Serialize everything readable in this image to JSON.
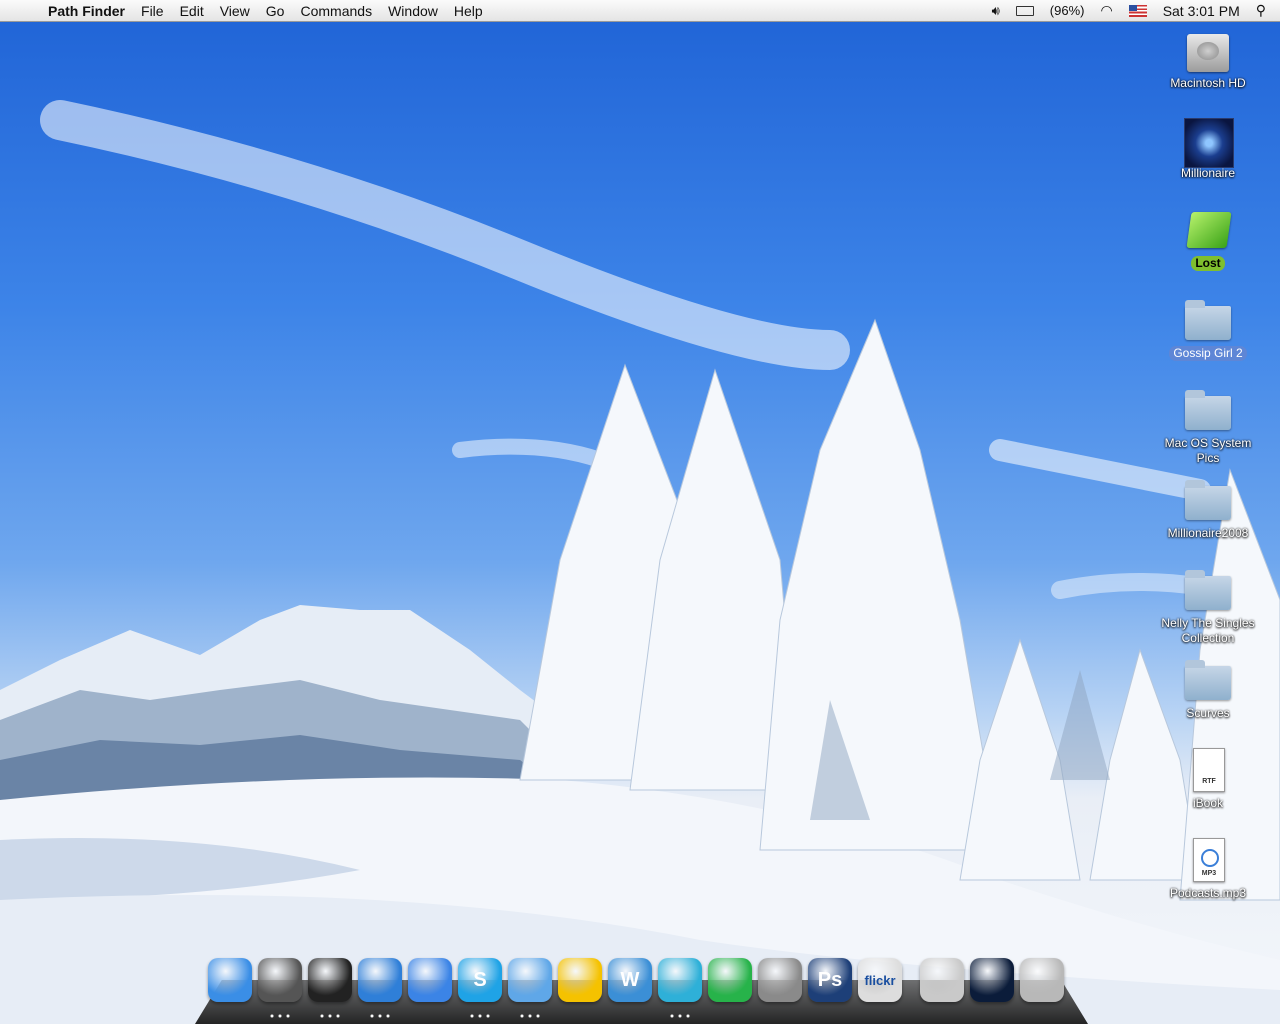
{
  "menubar": {
    "app_name": "Path Finder",
    "menus": [
      "File",
      "Edit",
      "View",
      "Go",
      "Commands",
      "Window",
      "Help"
    ],
    "battery": "(96%)",
    "clock": "Sat 3:01 PM"
  },
  "desktop_icons": [
    {
      "label": "Macintosh HD",
      "icon": "hard-drive-icon"
    },
    {
      "label": "Millionaire",
      "icon": "millionaire-app-icon"
    },
    {
      "label": "Lost",
      "icon": "green-folder-icon",
      "label_color": "#7fbf2e"
    },
    {
      "label": "Gossip Girl 2",
      "icon": "folder-icon",
      "label_color": "#5e86d6"
    },
    {
      "label": "Mac OS System Pics",
      "icon": "folder-icon"
    },
    {
      "label": "Millionaire2008",
      "icon": "folder-icon"
    },
    {
      "label": "Nelly The Singles Collection",
      "icon": "folder-icon"
    },
    {
      "label": "Scurves",
      "icon": "folder-icon"
    },
    {
      "label": "iBook",
      "icon": "rtf-document-icon",
      "badge": "RTF"
    },
    {
      "label": "Podcasts.mp3",
      "icon": "mp3-document-icon",
      "badge": "MP3"
    }
  ],
  "dock": {
    "apps": [
      {
        "name": "finder-icon",
        "running": false,
        "color": "#3a8ee6"
      },
      {
        "name": "stopwatch-icon",
        "running": true,
        "color": "#555555"
      },
      {
        "name": "dashboard-icon",
        "running": true,
        "color": "#222222"
      },
      {
        "name": "safari-icon",
        "running": true,
        "color": "#2f7fd8"
      },
      {
        "name": "ichat-icon",
        "running": false,
        "color": "#3b84e6"
      },
      {
        "name": "skype-icon",
        "running": true,
        "color": "#1fa3e6",
        "glyph": "S"
      },
      {
        "name": "itunes-icon",
        "running": true,
        "color": "#5fa7e8"
      },
      {
        "name": "yahoo-messenger-icon",
        "running": false,
        "color": "#f5c200"
      },
      {
        "name": "word-icon",
        "running": false,
        "color": "#3b8fd6",
        "glyph": "W"
      },
      {
        "name": "msn-messenger-icon",
        "running": true,
        "color": "#2eb0d8"
      },
      {
        "name": "cube-app-icon",
        "running": false,
        "color": "#27b34a"
      },
      {
        "name": "system-preferences-icon",
        "running": false,
        "color": "#8a8a8a"
      },
      {
        "name": "photoshop-icon",
        "running": false,
        "color": "#1d3f78",
        "glyph": "Ps"
      },
      {
        "name": "flickr-uploader-icon",
        "running": false,
        "color": "#dddddd",
        "glyph": "flickr"
      },
      {
        "name": "downloads-stack-icon",
        "running": false,
        "color": "#c9c9c9"
      },
      {
        "name": "desktop-stack-icon",
        "running": false,
        "color": "#0b1c3a"
      },
      {
        "name": "trash-icon",
        "running": false,
        "color": "#b8b8b8"
      }
    ]
  }
}
